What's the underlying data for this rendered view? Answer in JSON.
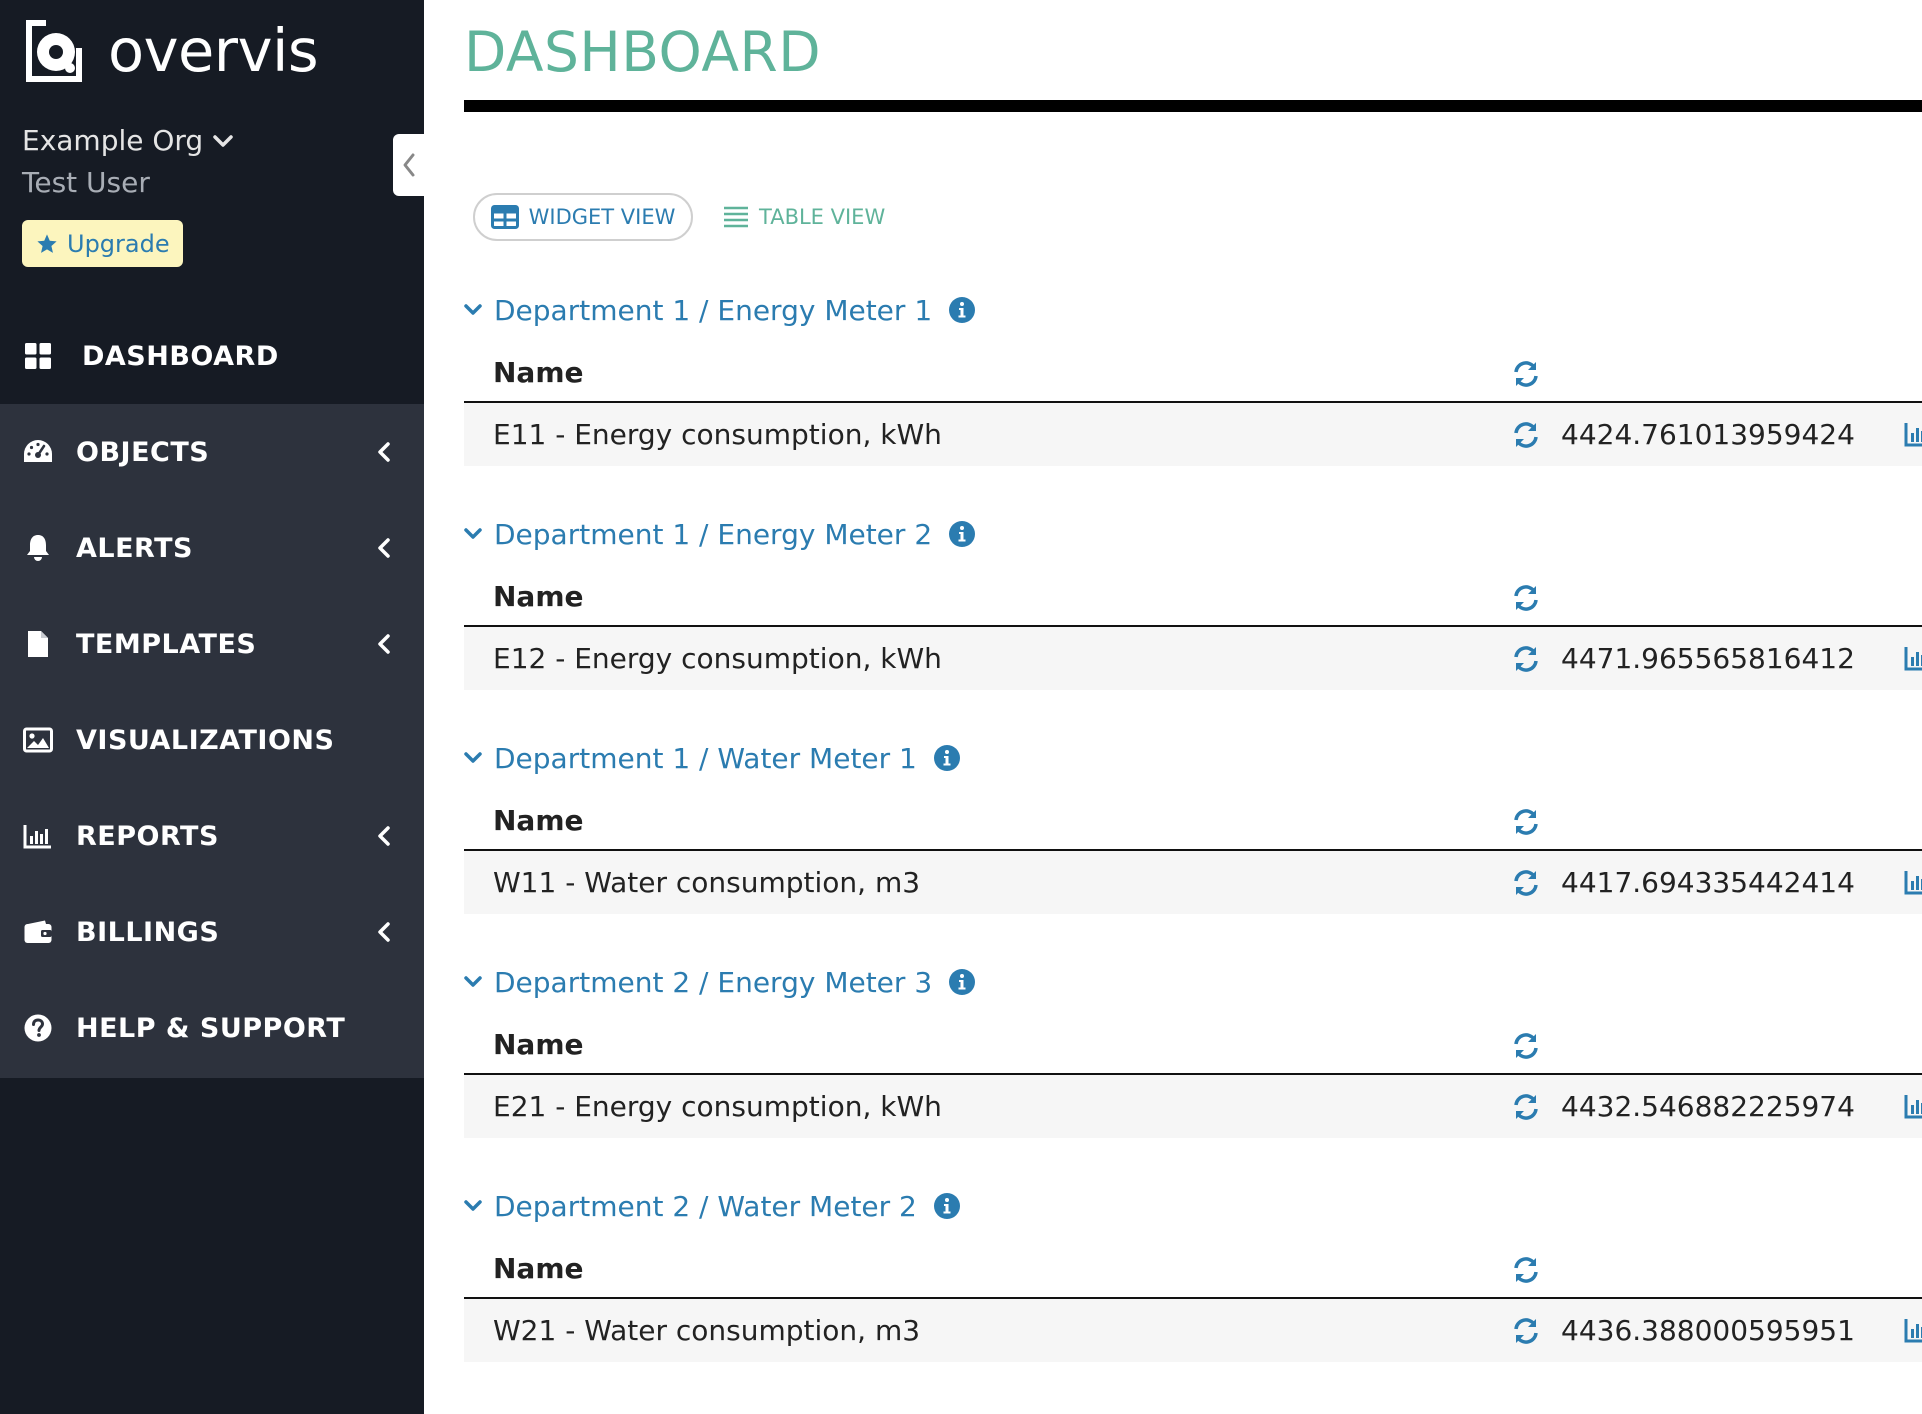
{
  "app": {
    "brand_name": "overvis",
    "org_name": "Example Org",
    "user_name": "Test User",
    "upgrade_label": "Upgrade"
  },
  "nav": {
    "items": [
      {
        "label": "DASHBOARD",
        "icon": "grid-icon",
        "active": true
      },
      {
        "label": "OBJECTS",
        "icon": "gauge-icon",
        "has_submenu": true
      },
      {
        "label": "ALERTS",
        "icon": "bell-icon",
        "has_submenu": true
      },
      {
        "label": "TEMPLATES",
        "icon": "file-icon",
        "has_submenu": true
      },
      {
        "label": "VISUALIZATIONS",
        "icon": "image-icon"
      },
      {
        "label": "REPORTS",
        "icon": "bar-chart-icon",
        "has_submenu": true
      },
      {
        "label": "BILLINGS",
        "icon": "wallet-icon",
        "has_submenu": true
      },
      {
        "label": "HELP & SUPPORT",
        "icon": "question-circle-icon"
      }
    ]
  },
  "page": {
    "title": "DASHBOARD",
    "widget_view_label": "WIDGET VIEW",
    "table_view_label": "TABLE VIEW",
    "active_view": "widget"
  },
  "sections": [
    {
      "title": "Department 1 / Energy Meter 1",
      "header_name": "Name",
      "row": {
        "name": "E11 - Energy consumption, kWh",
        "value": "4424.761013959424"
      }
    },
    {
      "title": "Department 1 / Energy Meter 2",
      "header_name": "Name",
      "row": {
        "name": "E12 - Energy consumption, kWh",
        "value": "4471.965565816412"
      }
    },
    {
      "title": "Department 1 / Water Meter 1",
      "header_name": "Name",
      "row": {
        "name": "W11 - Water consumption, m3",
        "value": "4417.694335442414"
      }
    },
    {
      "title": "Department 2 / Energy Meter 3",
      "header_name": "Name",
      "row": {
        "name": "E21 - Energy consumption, kWh",
        "value": "4432.546882225974"
      }
    },
    {
      "title": "Department 2 / Water Meter 2",
      "header_name": "Name",
      "row": {
        "name": "W21 - Water consumption, m3",
        "value": "4436.388000595951"
      }
    }
  ],
  "colors": {
    "sidebar_bg": "#161b24",
    "nav_bg": "#2d323d",
    "title_green": "#5fb39a",
    "link_blue": "#2b7cb0",
    "upgrade_bg": "#fcf5be",
    "row_bg": "#f6f6f6"
  }
}
